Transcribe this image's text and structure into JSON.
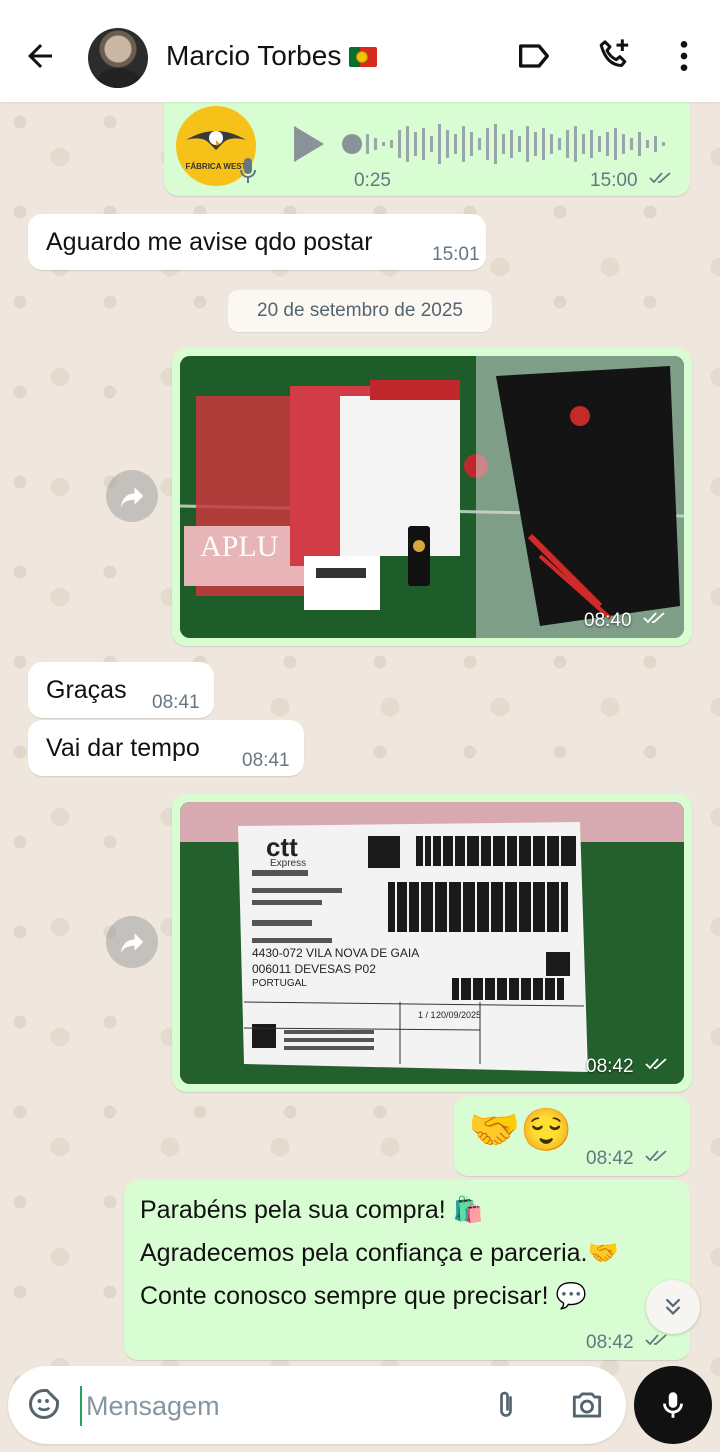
{
  "header": {
    "contact_name": "Marcio Torbes",
    "flag": "portugal-flag",
    "icons": [
      "back-arrow-icon",
      "label-icon",
      "add-call-icon",
      "more-vert-icon"
    ]
  },
  "messages": {
    "voice": {
      "duration": "0:25",
      "time": "15:00",
      "avatar_text": "FÁBRICA WEST"
    },
    "m1": {
      "text": "Aguardo me avise qdo postar",
      "time": "15:01"
    },
    "date_separator": "20 de setembro de 2025",
    "photo1": {
      "time": "08:40"
    },
    "m2": {
      "text": "Graças",
      "time": "08:41"
    },
    "m3": {
      "text": "Vai dar tempo",
      "time": "08:41"
    },
    "photo2": {
      "time": "08:42",
      "label_brand": "ctt",
      "label_sub": "Express",
      "city": "4430-072 VILA NOVA DE GAIA",
      "district": "006011 DEVESAS P02",
      "country": "PORTUGAL",
      "date": "20/09/2025",
      "count": "1 / 1"
    },
    "m4": {
      "emoji": "🤝😌",
      "time": "08:42"
    },
    "m5": {
      "line1": "Parabéns pela sua compra! 🛍️",
      "line2": "Agradecemos pela confiança e parceria.🤝",
      "line3": "Conte conosco sempre que precisar! 💬",
      "time": "08:42"
    }
  },
  "composer": {
    "placeholder": "Mensagem"
  },
  "colors": {
    "incoming": "#ffffff",
    "outgoing": "#d9fdd3",
    "tick": "#667781",
    "mic_bg": "#111111"
  }
}
